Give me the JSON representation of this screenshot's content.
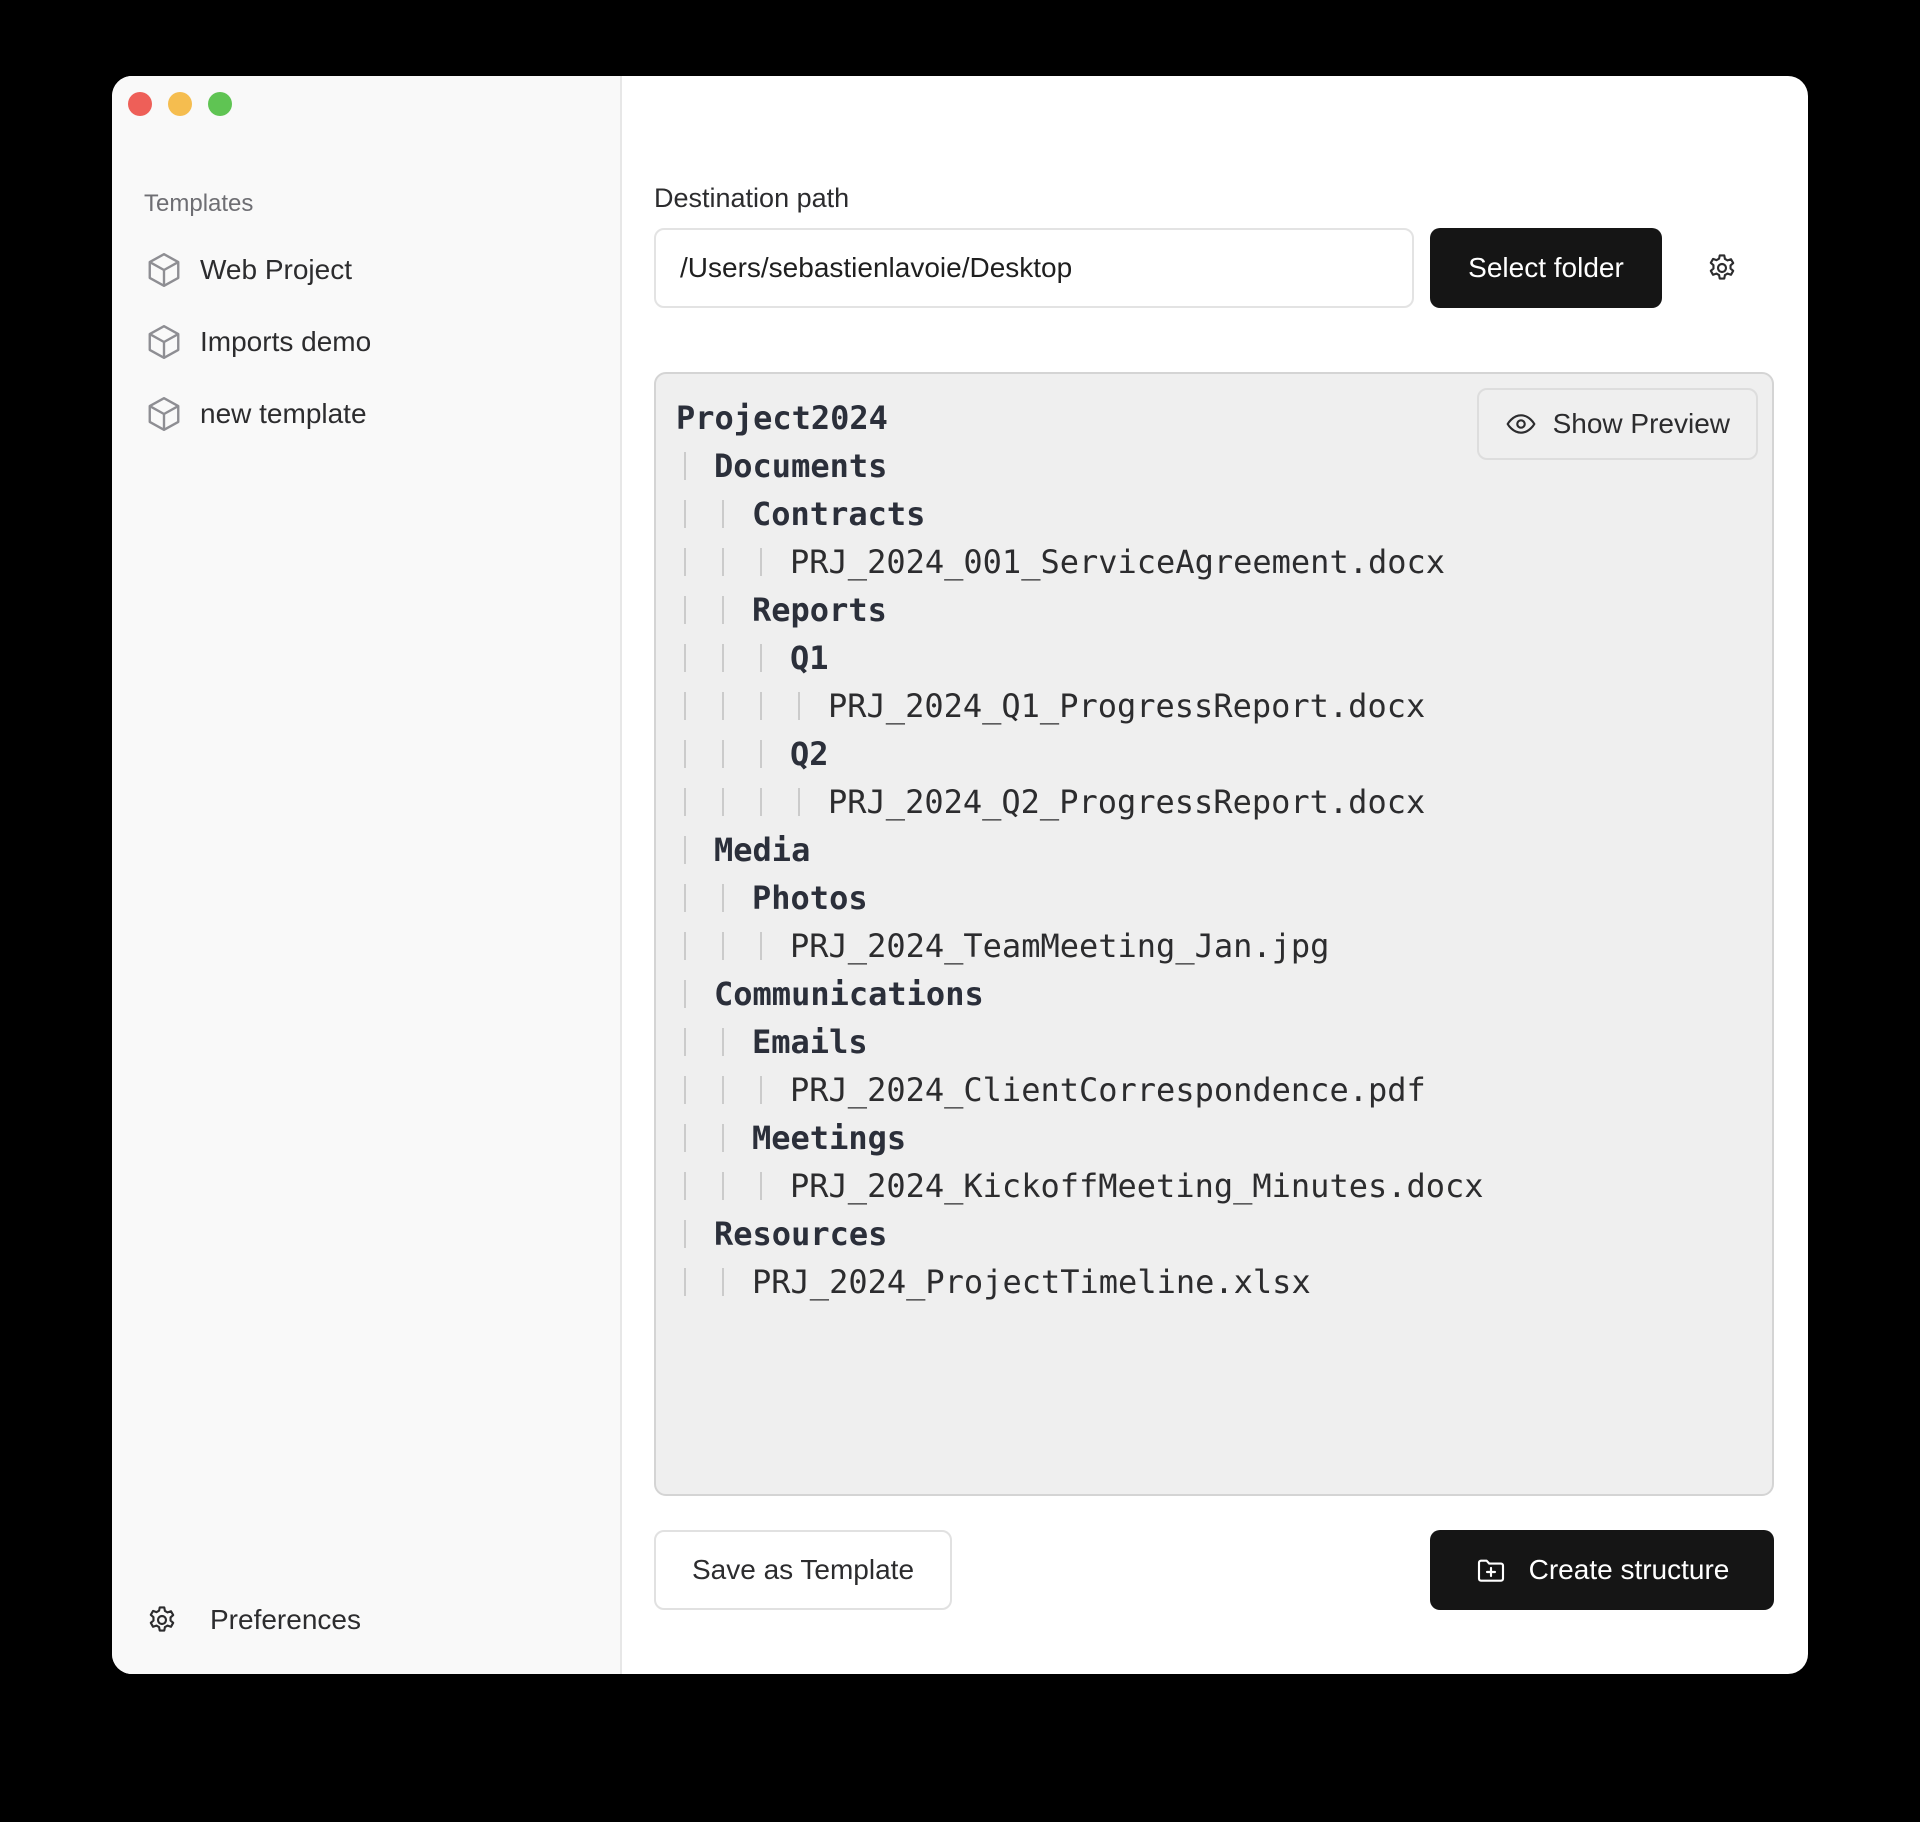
{
  "colors": {
    "close": "#ee5f58",
    "minimize": "#f5bd4f",
    "maximize": "#5fc453",
    "primary_button": "#151515",
    "sidebar_bg": "#f9f9f9",
    "tree_bg": "#efefef"
  },
  "sidebar": {
    "heading": "Templates",
    "items": [
      {
        "label": "Web Project",
        "icon": "cube-icon"
      },
      {
        "label": "Imports demo",
        "icon": "cube-icon"
      },
      {
        "label": "new template",
        "icon": "cube-icon"
      }
    ],
    "footer": {
      "label": "Preferences",
      "icon": "gear-icon"
    }
  },
  "main": {
    "destination_label": "Destination path",
    "destination_value": "/Users/sebastienlavoie/Desktop",
    "select_folder_label": "Select folder",
    "settings_icon": "gear-icon",
    "preview_button": {
      "label": "Show Preview",
      "icon": "eye-icon"
    },
    "tree": [
      {
        "depth": 0,
        "name": "Project2024",
        "type": "root"
      },
      {
        "depth": 1,
        "name": "Documents",
        "type": "folder"
      },
      {
        "depth": 2,
        "name": "Contracts",
        "type": "folder"
      },
      {
        "depth": 3,
        "name": "PRJ_2024_001_ServiceAgreement.docx",
        "type": "file"
      },
      {
        "depth": 2,
        "name": "Reports",
        "type": "folder"
      },
      {
        "depth": 3,
        "name": "Q1",
        "type": "folder"
      },
      {
        "depth": 4,
        "name": "PRJ_2024_Q1_ProgressReport.docx",
        "type": "file"
      },
      {
        "depth": 3,
        "name": "Q2",
        "type": "folder"
      },
      {
        "depth": 4,
        "name": "PRJ_2024_Q2_ProgressReport.docx",
        "type": "file"
      },
      {
        "depth": 1,
        "name": "Media",
        "type": "folder"
      },
      {
        "depth": 2,
        "name": "Photos",
        "type": "folder"
      },
      {
        "depth": 3,
        "name": "PRJ_2024_TeamMeeting_Jan.jpg",
        "type": "file"
      },
      {
        "depth": 1,
        "name": "Communications",
        "type": "folder"
      },
      {
        "depth": 2,
        "name": "Emails",
        "type": "folder"
      },
      {
        "depth": 3,
        "name": "PRJ_2024_ClientCorrespondence.pdf",
        "type": "file"
      },
      {
        "depth": 2,
        "name": "Meetings",
        "type": "folder"
      },
      {
        "depth": 3,
        "name": "PRJ_2024_KickoffMeeting_Minutes.docx",
        "type": "file"
      },
      {
        "depth": 1,
        "name": "Resources",
        "type": "folder"
      },
      {
        "depth": 2,
        "name": "PRJ_2024_ProjectTimeline.xlsx",
        "type": "file"
      }
    ],
    "save_template_label": "Save as Template",
    "create_structure": {
      "label": "Create structure",
      "icon": "folder-plus-icon"
    }
  }
}
